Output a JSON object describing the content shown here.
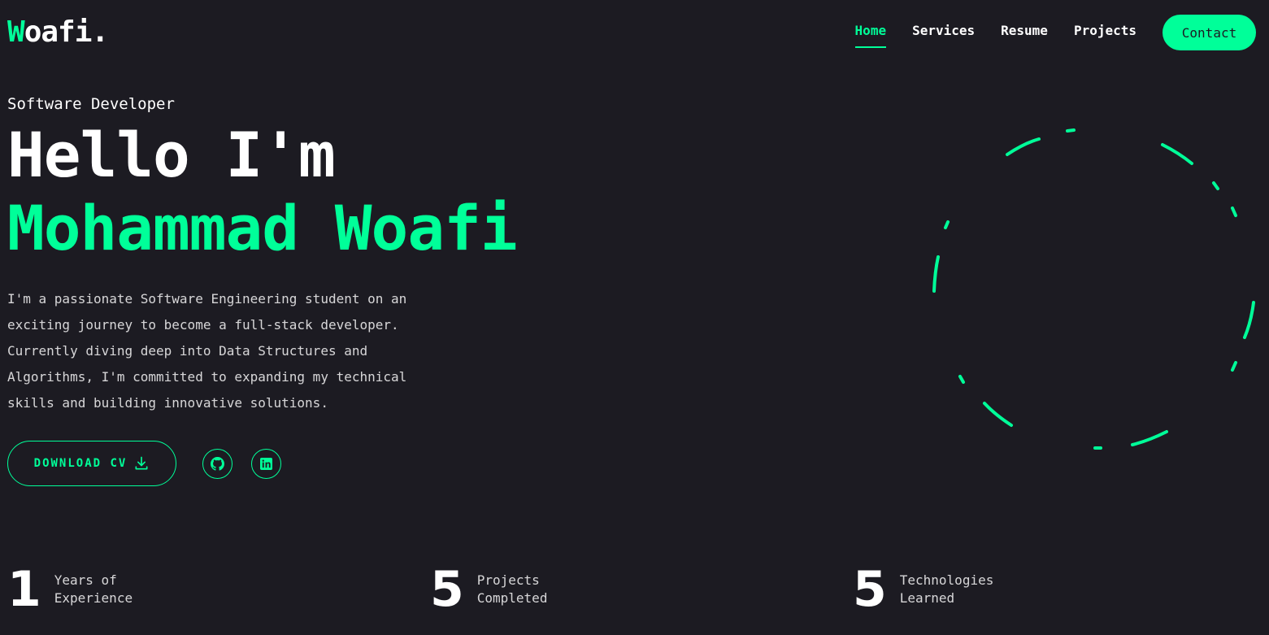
{
  "brand": {
    "logo_first_letter": "W",
    "logo_rest": "oafi.",
    "accent_color": "#00ff99",
    "background_color": "#1c1b22"
  },
  "nav": {
    "items": [
      {
        "label": "Home",
        "active": true
      },
      {
        "label": "Services",
        "active": false
      },
      {
        "label": "Resume",
        "active": false
      },
      {
        "label": "Projects",
        "active": false
      }
    ],
    "contact_label": "Contact"
  },
  "hero": {
    "subtitle": "Software Developer",
    "greeting": "Hello I'm",
    "name": "Mohammad Woafi",
    "bio": "I'm a passionate Software Engineering student on an exciting journey to become a full-stack developer. Currently diving deep into Data Structures and Algorithms, I'm committed to expanding my technical skills and building innovative solutions.",
    "cv_button_label": "DOWNLOAD CV",
    "cv_icon": "download-icon",
    "socials": [
      {
        "icon": "github-icon"
      },
      {
        "icon": "linkedin-icon"
      }
    ]
  },
  "stats": [
    {
      "number": "1",
      "label_line1": "Years of",
      "label_line2": "Experience"
    },
    {
      "number": "5",
      "label_line1": "Projects",
      "label_line2": "Completed"
    },
    {
      "number": "5",
      "label_line1": "Technologies",
      "label_line2": "Learned"
    }
  ]
}
